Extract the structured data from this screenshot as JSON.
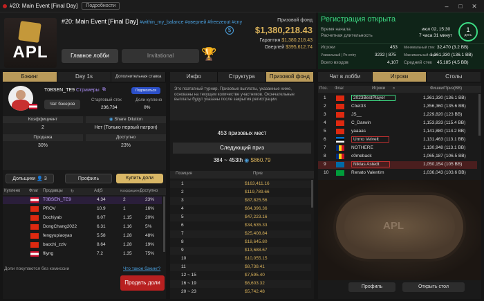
{
  "window": {
    "title": "#20: Main Event [Final Day]",
    "details_button": "Подробности"
  },
  "header": {
    "logo_text": "APL",
    "event_title": "#20: Main Event [Final Day]",
    "tags": "#within_my_balance #оверлей #freezeout #cny",
    "main_lobby": "Главное лобби",
    "invitational": "Invitational",
    "prize_fund_label": "Призовой фонд",
    "prize_fund": "$1,380,218.43",
    "guarantee_label": "Гарантия",
    "guarantee": "$1,380,218.43",
    "overlay_label": "Оверлей",
    "overlay": "$395,612.74"
  },
  "registration": {
    "title": "Регистрация открыта",
    "start_label": "Время начала",
    "start": "июл 02, 15:30",
    "duration_label": "Расчетная длительность",
    "duration": "7 часа 31 минут",
    "day_number": "1",
    "day_label": "день",
    "players_label": "Игроки",
    "players": "453",
    "unique_label": "Уникальный | Ре-entry",
    "unique": "3232 | 875",
    "entries_label": "Всего входов",
    "entries": "4,107",
    "min_stack_label": "Минимальный стек",
    "min_stack": "32,470 (3.2 BB)",
    "max_stack_label": "Максимальный стек",
    "max_stack": "1,361,330 (136.1 BB)",
    "avg_stack_label": "Средний стек",
    "avg_stack": "45,185 (4.5 BB)"
  },
  "left": {
    "tabs": [
      "Бэкинг",
      "Day 1s",
      "Дополнительная ставка"
    ],
    "player_name": "T0BSEN_TE9",
    "streamers": "Стримеры",
    "subscribed": "Подписаться",
    "backers_chat": "Чат бэкеров",
    "start_stack_label": "Стартовый стек",
    "start_stack": "236,734",
    "shares_bought_label": "Доли куплено",
    "shares_bought": "0%",
    "coefficient_label": "Коэффициент",
    "coefficient": "2",
    "share_dilution_label": "Share Dilution",
    "share_dilution": "Нет (Только первый патрон)",
    "sale_label": "Продажа",
    "sale": "30%",
    "available_label": "Доступно",
    "available": "23%",
    "shareholders": "Дольщики",
    "shareholders_count": "3",
    "profile": "Профиль",
    "buy_shares": "Купить доли",
    "table_headers": [
      "Куплено",
      "Флаг",
      "Продавцы",
      "AdjS",
      "Коэффициент",
      "Доступно"
    ],
    "rows": [
      {
        "name": "T0BSEN_TE9",
        "adj": "4.34",
        "coef": "2",
        "avail": "23%",
        "flag": "at"
      },
      {
        "name": "PROV",
        "adj": "10.9",
        "coef": "1",
        "avail": "16%",
        "flag": "cn"
      },
      {
        "name": "Dochiyab",
        "adj": "6.07",
        "coef": "1.15",
        "avail": "20%",
        "flag": "hk"
      },
      {
        "name": "DongChang2022",
        "adj": "6.31",
        "coef": "1.16",
        "avail": "5%",
        "flag": "hk"
      },
      {
        "name": "fengyupiaoyao",
        "adj": "5.58",
        "coef": "1.28",
        "avail": "48%",
        "flag": "cn"
      },
      {
        "name": "baochi_zzlv",
        "adj": "8.64",
        "coef": "1.28",
        "avail": "19%",
        "flag": "cn"
      },
      {
        "name": "fliyng",
        "adj": "7.2",
        "coef": "1.35",
        "avail": "75%",
        "flag": "at"
      }
    ],
    "commission_note": "Доли покупаются без комиссии",
    "what_is_backing": "Что такое бэкинг?",
    "sell_shares": "Продать доли"
  },
  "middle": {
    "tabs": [
      "Инфо",
      "Структура",
      "Призовой фонд"
    ],
    "notice": "Это поэтапный турнир. Призовые выплаты, указанные ниже, основаны на текущем количестве участников. Окончательные выплаты будут указаны после закрытия регистрации.",
    "places": "453 призовых мест",
    "next_prize_label": "Следующий приз",
    "next_range": "384 ~ 453th",
    "next_prize": "$860.79",
    "col_position": "Позиция",
    "col_prize": "Приз",
    "prizes": [
      {
        "pos": "1",
        "prize": "$163,411.16"
      },
      {
        "pos": "2",
        "prize": "$119,789.66"
      },
      {
        "pos": "3",
        "prize": "$87,825.56"
      },
      {
        "pos": "4",
        "prize": "$64,396.36"
      },
      {
        "pos": "5",
        "prize": "$47,223.16"
      },
      {
        "pos": "6",
        "prize": "$34,635.33"
      },
      {
        "pos": "7",
        "prize": "$25,408.84"
      },
      {
        "pos": "8",
        "prize": "$18,645.80"
      },
      {
        "pos": "9",
        "prize": "$13,688.67"
      },
      {
        "pos": "10",
        "prize": "$10,055.15"
      },
      {
        "pos": "11",
        "prize": "$8,738.41"
      },
      {
        "pos": "12 ~ 15",
        "prize": "$7,595.40"
      },
      {
        "pos": "16 ~ 19",
        "prize": "$6,603.32"
      },
      {
        "pos": "20 ~ 23",
        "prize": "$5,742.48"
      }
    ]
  },
  "right": {
    "tabs": [
      "Чат в лобби",
      "Игроки",
      "Столы"
    ],
    "col_pos": "Поз.",
    "col_flag": "Флаг",
    "col_players": "Игроки",
    "col_chips": "Фишки/Приз(BB)",
    "players": [
      {
        "pos": "1",
        "name": "2023BestPlayer",
        "chips": "1,361,330 (136.1 BB)",
        "flag": "cn"
      },
      {
        "pos": "2",
        "name": "Cbet33",
        "chips": "1,356,360 (135.6 BB)",
        "flag": "cn"
      },
      {
        "pos": "3",
        "name": "JS__",
        "chips": "1,229,820 (123 BB)",
        "flag": "hk"
      },
      {
        "pos": "4",
        "name": "C_Darwin",
        "chips": "1,153,833 (115.4 BB)",
        "flag": "hk"
      },
      {
        "pos": "5",
        "name": "yaaaas",
        "chips": "1,141,880 (114.2 BB)",
        "flag": "cn"
      },
      {
        "pos": "6",
        "name": "Urmo Velvelt",
        "chips": "1,131,463 (113.1 BB)",
        "flag": "ee"
      },
      {
        "pos": "7",
        "name": "NOTHERE",
        "chips": "1,130,948 (113.1 BB)",
        "flag": "ro"
      },
      {
        "pos": "8",
        "name": "c0meback",
        "chips": "1,065,187 (106.5 BB)",
        "flag": "ro"
      },
      {
        "pos": "9",
        "name": "Niklas Astedt",
        "chips": "1,050,154 (105 BB)",
        "flag": "se"
      },
      {
        "pos": "10",
        "name": "Renato Valentim",
        "chips": "1,036,043 (103.6 BB)",
        "flag": "br"
      }
    ],
    "table_logo": "APL",
    "profile": "Профиль",
    "open_table": "Открыть стол"
  }
}
